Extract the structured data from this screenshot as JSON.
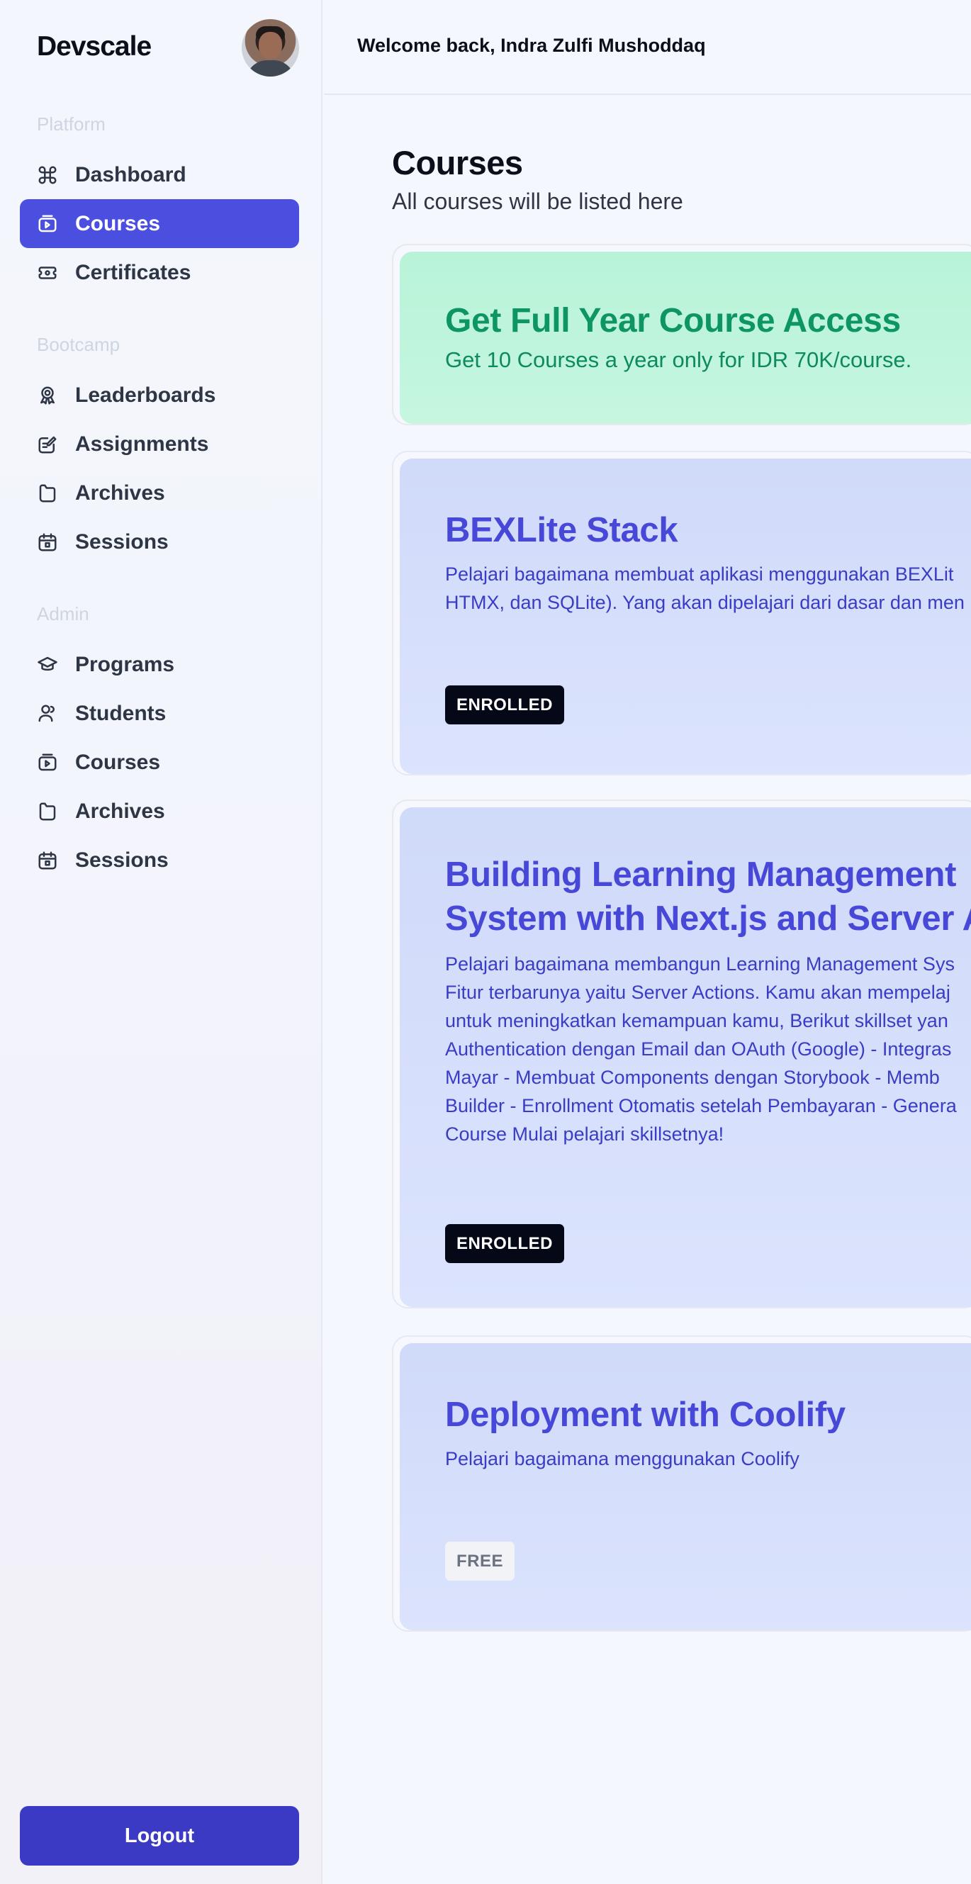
{
  "brand": "Devscale",
  "header": {
    "welcome": "Welcome back, Indra Zulfi Mushoddaq"
  },
  "sidebar": {
    "sections": [
      {
        "label": "Platform"
      },
      {
        "label": "Bootcamp"
      },
      {
        "label": "Admin"
      }
    ],
    "platform_items": [
      {
        "label": "Dashboard",
        "icon": "command-icon"
      },
      {
        "label": "Courses",
        "icon": "video-icon",
        "active": true
      },
      {
        "label": "Certificates",
        "icon": "ticket-icon"
      }
    ],
    "bootcamp_items": [
      {
        "label": "Leaderboards",
        "icon": "award-icon"
      },
      {
        "label": "Assignments",
        "icon": "edit-note-icon"
      },
      {
        "label": "Archives",
        "icon": "folder-icon"
      },
      {
        "label": "Sessions",
        "icon": "calendar-icon"
      }
    ],
    "admin_items": [
      {
        "label": "Programs",
        "icon": "graduation-cap-icon"
      },
      {
        "label": "Students",
        "icon": "users-icon"
      },
      {
        "label": "Courses",
        "icon": "video-icon"
      },
      {
        "label": "Archives",
        "icon": "folder-icon"
      },
      {
        "label": "Sessions",
        "icon": "calendar-icon"
      }
    ],
    "logout": "Logout"
  },
  "main": {
    "title": "Courses",
    "subtitle": "All courses will be listed here",
    "promo": {
      "title": "Get Full Year Course Access",
      "subtitle": "Get 10 Courses a year only for IDR 70K/course."
    },
    "courses": [
      {
        "title": "BEXLite Stack",
        "description": [
          "Pelajari bagaimana membuat aplikasi menggunakan BEXLit",
          "HTMX, dan SQLite). Yang akan dipelajari dari dasar dan men"
        ],
        "badge": "ENROLLED"
      },
      {
        "title_lines": [
          "Building Learning Management",
          "System with Next.js and Server Ac"
        ],
        "description": [
          "Pelajari bagaimana membangun Learning Management Sys",
          "Fitur terbarunya yaitu Server Actions. Kamu akan mempelaj",
          "untuk meningkatkan kemampuan kamu, Berikut skillset yan",
          "Authentication dengan Email dan OAuth (Google) - Integras",
          "Mayar - Membuat Components dengan Storybook - Memb",
          "Builder - Enrollment Otomatis setelah Pembayaran - Genera",
          "Course Mulai pelajari skillsetnya!"
        ],
        "badge": "ENROLLED"
      },
      {
        "title": "Deployment with Coolify",
        "description": [
          "Pelajari bagaimana menggunakan Coolify"
        ],
        "badge": "FREE"
      }
    ]
  },
  "colors": {
    "accent": "#4a4fe0",
    "logout": "#3b3ac4",
    "course_title": "#4748d8",
    "promo_title": "#0d9564",
    "badge_enrolled": "#050816"
  }
}
